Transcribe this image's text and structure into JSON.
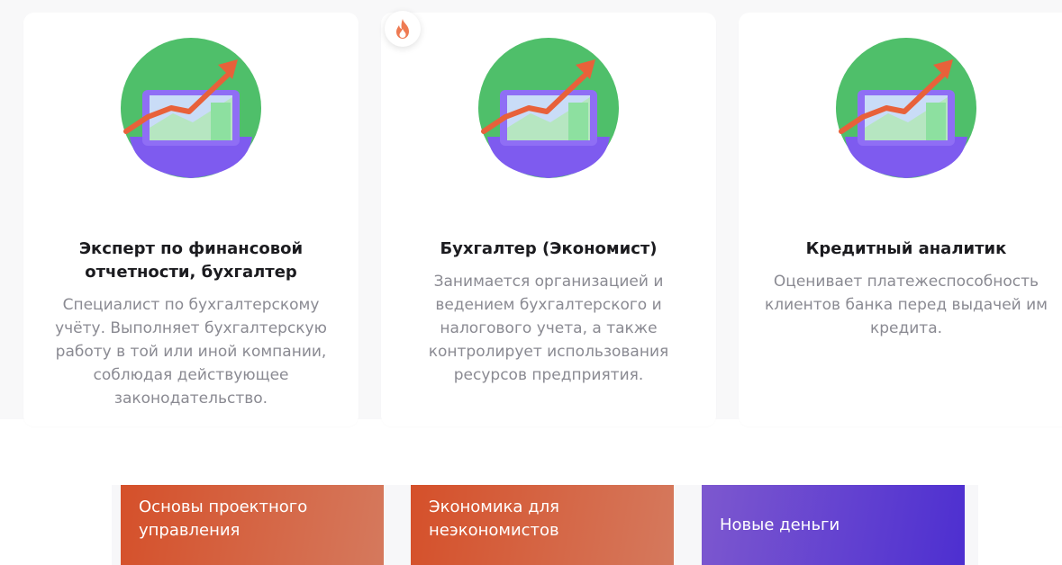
{
  "cards": [
    {
      "title": "Эксперт по финансовой отчетности, бухгалтер",
      "description": "Специалист по бухгалтерскому учёту. Выполняет бухгалтерскую работу в той или иной компании, соблюдая действующее законодательство."
    },
    {
      "title": "Бухгалтер (Экономист)",
      "description": "Занимается организацией и ведением бухгалтерского и налогового учета, а также контролирует использования ресурсов предприятия."
    },
    {
      "title": "Кредитный аналитик",
      "description": "Оценивает платежеспособность клиентов банка перед выдачей им кредита."
    }
  ],
  "badge_icon": "fire-icon",
  "illustration_icon": "growth-chart-laptop-icon",
  "courses": [
    {
      "label": "Основы проектного управления"
    },
    {
      "label": "Экономика для неэкономистов"
    },
    {
      "label": "Новые деньги"
    }
  ],
  "colors": {
    "accent_orange": "#d5502a",
    "accent_purple": "#4d2fd0",
    "illustration_green": "#4fbf6a",
    "arrow": "#e8613a"
  }
}
